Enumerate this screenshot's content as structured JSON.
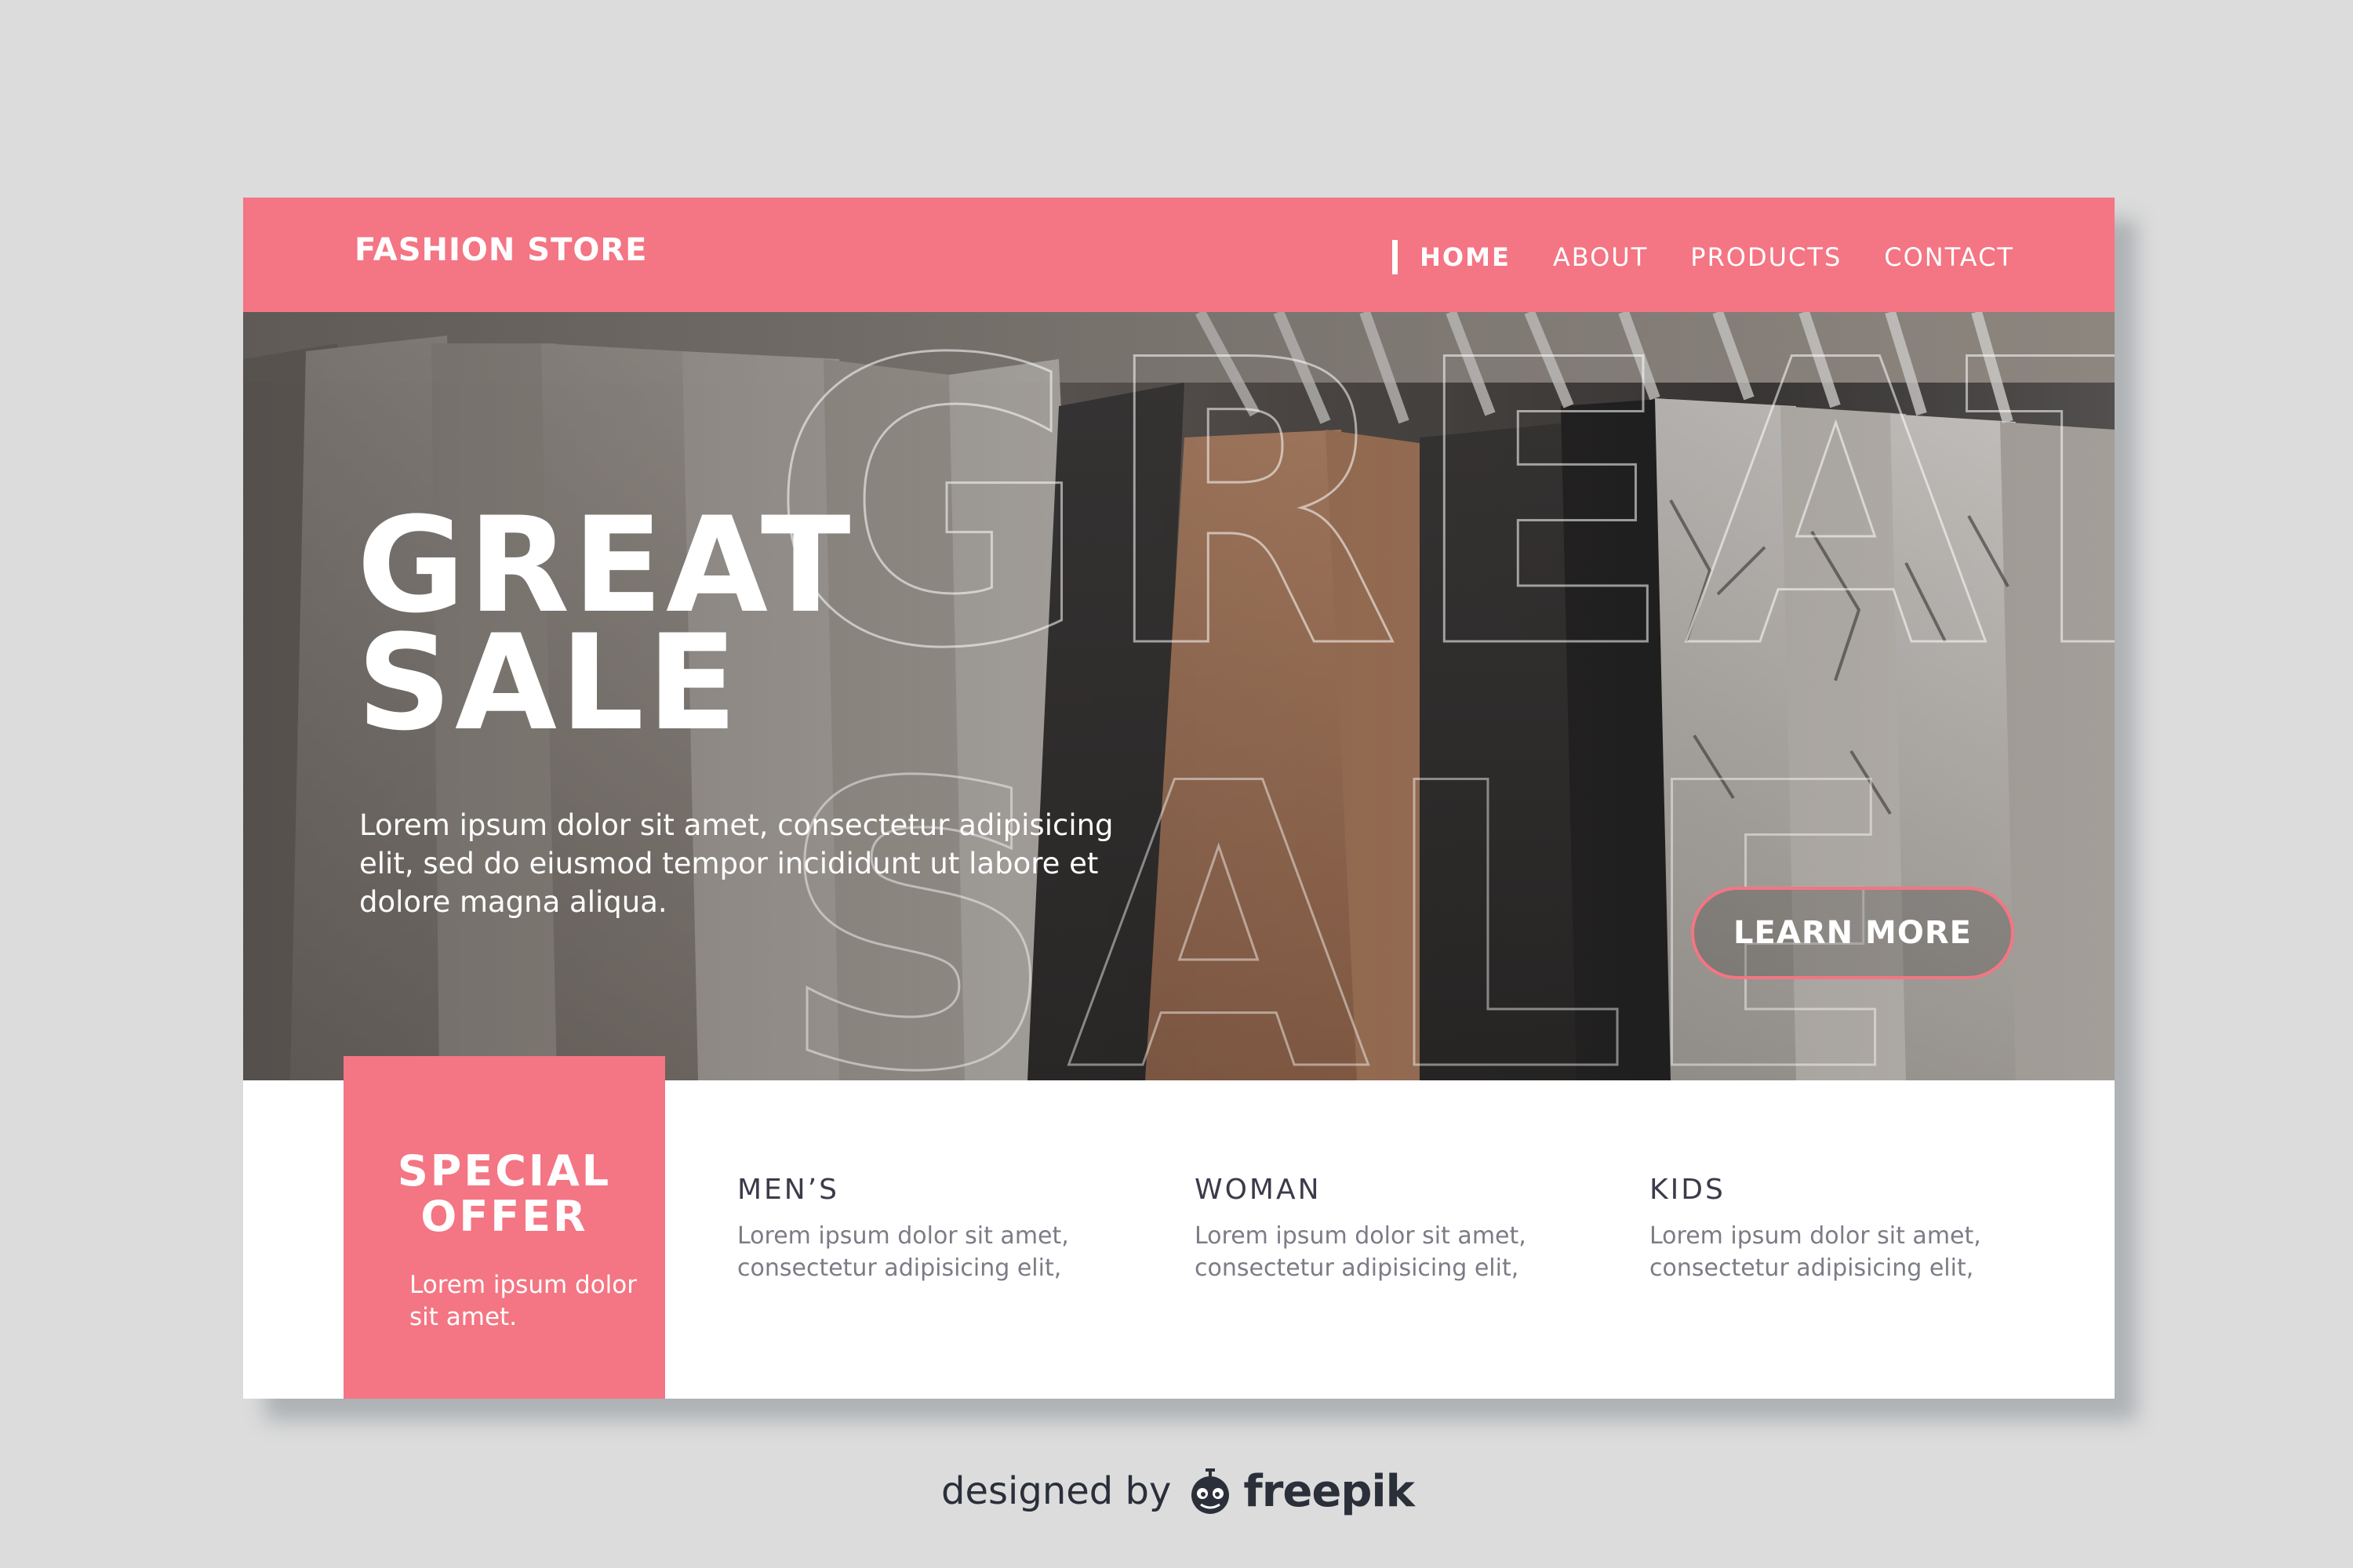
{
  "header": {
    "brand": "FASHION STORE",
    "nav": [
      "HOME",
      "ABOUT",
      "PRODUCTS",
      "CONTACT"
    ],
    "active_nav": "HOME"
  },
  "hero": {
    "title_line1": "GREAT",
    "title_line2": "SALE",
    "outline_line1": "GREAT",
    "outline_line2": "SALE",
    "body": "Lorem ipsum dolor sit amet, consectetur adipisicing elit, sed do eiusmod tempor incididunt ut labore et dolore magna aliqua.",
    "button_label": "LEARN MORE"
  },
  "offer": {
    "title_line1": "SPECIAL",
    "title_line2": "OFFER",
    "text": "Lorem ipsum dolor sit amet."
  },
  "categories": [
    {
      "title": "MEN’S",
      "text": "Lorem ipsum dolor sit amet, consectetur adipisicing elit,"
    },
    {
      "title": "WOMAN",
      "text": "Lorem ipsum dolor sit amet, consectetur adipisicing elit,"
    },
    {
      "title": "KIDS",
      "text": "Lorem ipsum dolor sit amet, consectetur adipisicing elit,"
    }
  ],
  "credit": {
    "prefix": "designed by",
    "brand": "freepik"
  },
  "colors": {
    "accent": "#f47583",
    "background": "#dcdcdc",
    "text_dark": "#3b3b4a",
    "text_muted": "#7b7c86"
  },
  "icons": {
    "credit_logo": "freepik-logo-icon"
  }
}
